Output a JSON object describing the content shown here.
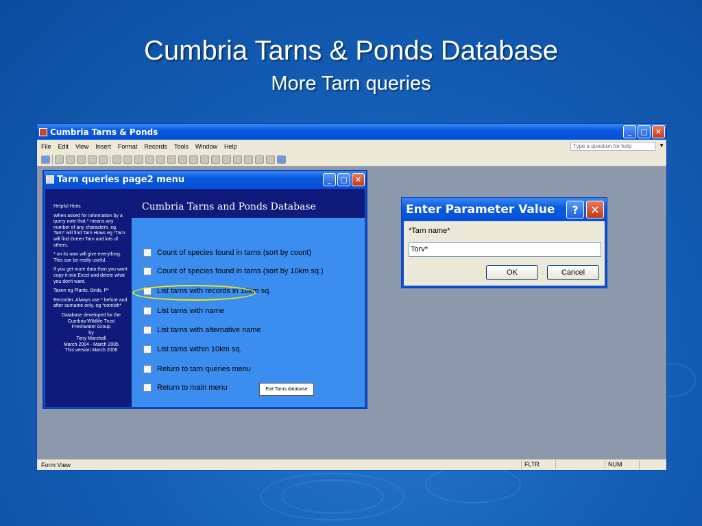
{
  "slide": {
    "title": "Cumbria Tarns & Ponds Database",
    "subtitle": "More Tarn queries"
  },
  "app": {
    "title": "Cumbria Tarns & Ponds",
    "menu": [
      "File",
      "Edit",
      "View",
      "Insert",
      "Format",
      "Records",
      "Tools",
      "Window",
      "Help"
    ],
    "help_placeholder": "Type a question for help",
    "status": {
      "left": "Form View",
      "fltr": "FLTR",
      "num": "NUM"
    }
  },
  "form": {
    "title": "Tarn queries page2 menu",
    "header": "Cumbria Tarns and Ponds Database",
    "hints": [
      "Helpful Hints",
      "When asked for information by a query note that * means any number of any characters. eg. Tarn* will find Tarn Hows eg *Tarn will find Green Tarn and lots of others.",
      "* on its own will give everything. This can be really useful.",
      "If you get more data than you want copy it into Excel and delete what you don't want.",
      "Taxon eg Plants, Birds, P*",
      "Recorder. Always use * before and after surname only. eg *cornish*"
    ],
    "credit": [
      "Database developed for the",
      "Cumbria Wildlife Trust",
      "Freshwater Group",
      "by",
      "Tony Marshall",
      "March 2004 - March 2005",
      "This version March 2008"
    ],
    "items": [
      "Count of species found in tarns (sort by count)",
      "Count of species found in tarns (sort by 10km sq.)",
      "List tarns with records in 10km sq.",
      "List tarns with name",
      "List tarns with alternative name",
      "List tarns within 10km sq.",
      "Return to tarn queries menu",
      "Return to main menu"
    ],
    "exit_label": "Exit Tarns database"
  },
  "dialog": {
    "title": "Enter Parameter Value",
    "prompt": "*Tarn name*",
    "value": "Torv*",
    "ok": "OK",
    "cancel": "Cancel"
  }
}
